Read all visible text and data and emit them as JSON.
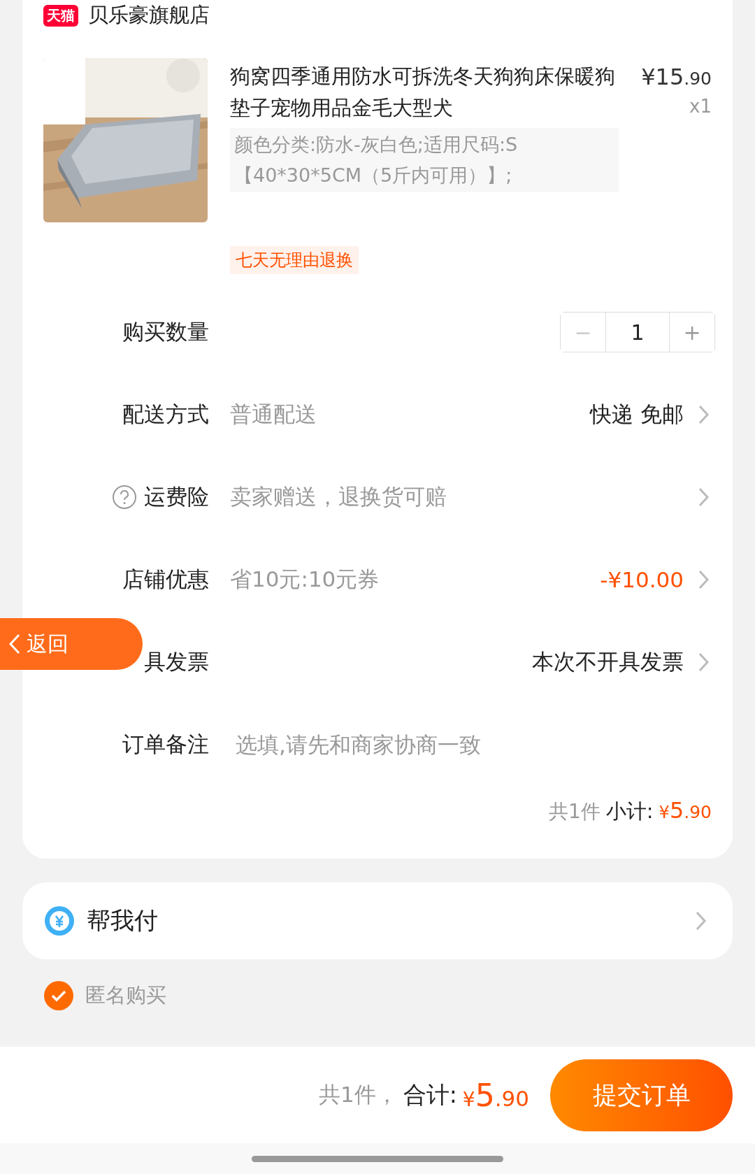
{
  "store": {
    "badge": "天猫",
    "name": "贝乐豪旗舰店"
  },
  "item": {
    "title": "狗窝四季通用防水可拆洗冬天狗狗床保暖狗垫子宠物用品金毛大型犬",
    "price_main": "¥15",
    "price_decimal": ".90",
    "quantity": "x1",
    "spec": "颜色分类:防水-灰白色;适用尺码:S【40*30*5CM（5斤内可用）】;",
    "tag": "七天无理由退换"
  },
  "rows": [
    {
      "kind": "stepper",
      "label": "购买数量",
      "minus": "−",
      "value": "1",
      "plus": "+",
      "minus_disabled": true
    },
    {
      "kind": "select",
      "label": "配送方式",
      "value": "普通配送",
      "right": "快递 免邮"
    },
    {
      "kind": "help",
      "label": "运费险",
      "value": "卖家赠送，退换货可赔"
    },
    {
      "kind": "discount",
      "label": "店铺优惠",
      "value": "省10元:10元券",
      "right": "-¥10.00"
    },
    {
      "kind": "select",
      "label": "具发票",
      "right": "本次不开具发票"
    },
    {
      "kind": "note",
      "label": "订单备注",
      "placeholder": "选填,请先和商家协商一致"
    }
  ],
  "subtotal": {
    "count": "共1件",
    "label": "小计:",
    "currency": "¥",
    "main": "5",
    "decimal": ".90"
  },
  "pay_for_me": {
    "label": "帮我付"
  },
  "anonymous": {
    "label": "匿名购买",
    "checked": true
  },
  "back_button": {
    "label": "返回"
  },
  "footer": {
    "count": "共1件，",
    "label": "合计:",
    "currency": "¥",
    "main": "5",
    "decimal": ".90",
    "submit": "提交订单"
  }
}
